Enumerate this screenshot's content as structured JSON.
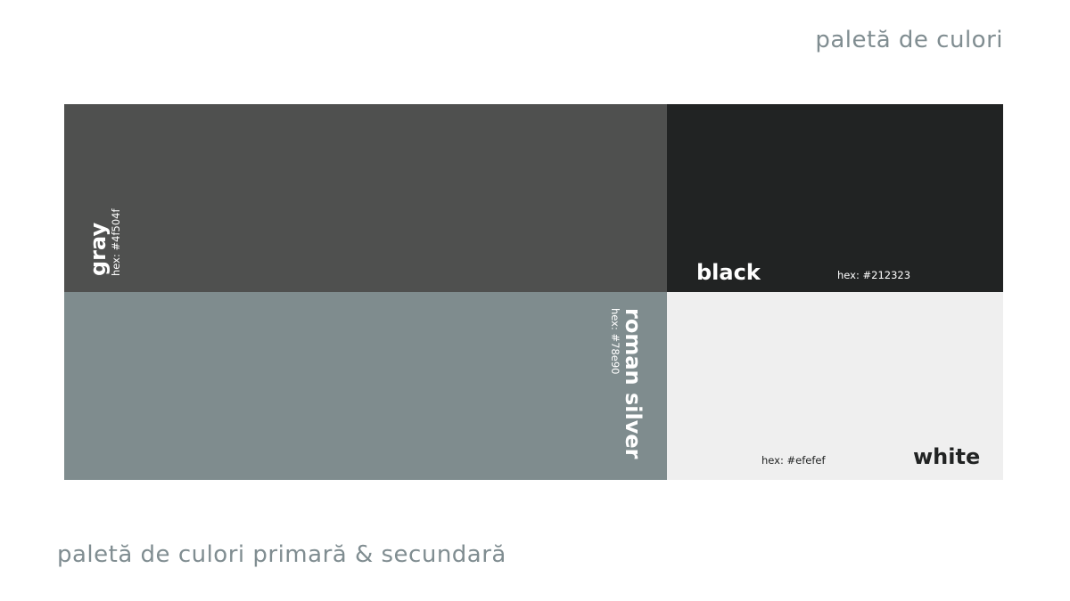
{
  "header": {
    "title": "paletă de culori"
  },
  "footer": {
    "title": "paletă de culori primară & secundară"
  },
  "swatches": {
    "gray": {
      "name": "gray",
      "hex_label": "hex: #4f504f",
      "color": "#4f504f"
    },
    "black": {
      "name": "black",
      "hex_label": "hex: #212323",
      "color": "#212323"
    },
    "roman": {
      "name": "roman silver",
      "hex_label": "hex: #78e90",
      "color": "#7f8c8e"
    },
    "white": {
      "name": "white",
      "hex_label": "hex: #efefef",
      "color": "#efefef"
    }
  },
  "colors": {
    "heading_text": "#808d91",
    "light_text": "#ffffff",
    "dark_text": "#212323"
  }
}
